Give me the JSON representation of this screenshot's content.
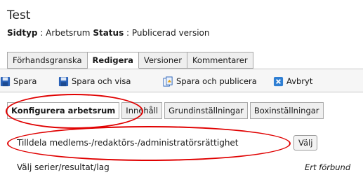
{
  "page": {
    "title": "Test",
    "meta": {
      "type_label": "Sidtyp",
      "type_value": "Arbetsrum",
      "status_label": "Status",
      "status_value": "Publicerad version"
    }
  },
  "mode_tabs": [
    {
      "label": "Förhandsgranska"
    },
    {
      "label": "Redigera"
    },
    {
      "label": "Versioner"
    },
    {
      "label": "Kommentarer"
    }
  ],
  "toolbar": {
    "save": "Spara",
    "save_and_view": "Spara och visa",
    "save_and_publish": "Spara och publicera",
    "cancel": "Avbryt"
  },
  "sub_tabs": [
    {
      "label": "Konfigurera arbetsrum"
    },
    {
      "label": "Innehåll"
    },
    {
      "label": "Grundinställningar"
    },
    {
      "label": "Boxinställningar"
    }
  ],
  "form": {
    "assign_rights_label": "Tilldela medlems-/redaktörs-/administratörsrättighet",
    "choose_button": "Välj",
    "series_label": "Välj serier/resultat/lag",
    "right_text": "Ert förbund"
  },
  "colors": {
    "highlight_ring": "#e00000",
    "save_icon": "#2a62b8",
    "cancel_icon": "#2f7fd3"
  },
  "icons": {
    "save": "floppy-disk-icon",
    "save_and_view": "floppy-disk-icon",
    "save_and_publish": "publish-pages-icon",
    "cancel": "cancel-x-icon"
  }
}
